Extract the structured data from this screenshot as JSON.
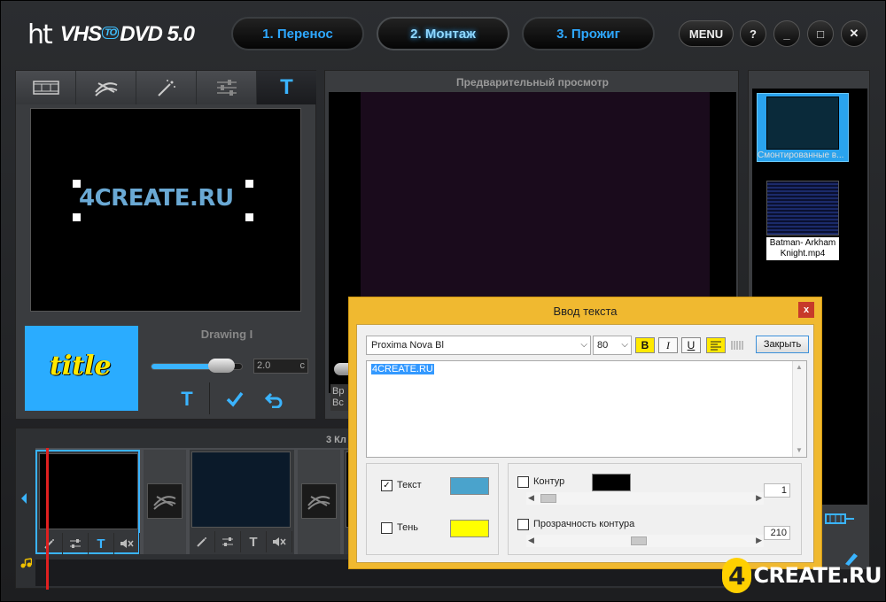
{
  "app": {
    "logo_ht": "ht",
    "logo_vhs": "VHS",
    "logo_to": "TO",
    "logo_dvd": "DVD 5.0"
  },
  "steps": [
    {
      "label": "1. Перенос",
      "active": false
    },
    {
      "label": "2. Монтаж",
      "active": true
    },
    {
      "label": "3. Прожиг",
      "active": false
    }
  ],
  "window_controls": {
    "menu": "MENU",
    "help": "?",
    "minimize": "_",
    "maximize": "□",
    "close": "✕"
  },
  "editor": {
    "canvas_text": "4CREATE.RU",
    "title_thumb_text": "title",
    "style_label": "Drawing I",
    "duration_value": "2.0",
    "duration_unit": "c",
    "duration_fraction": 0.77
  },
  "preview": {
    "title": "Предварительный просмотр",
    "info_line1": "Вр",
    "info_line2": "Вс"
  },
  "media": {
    "items": [
      {
        "label": "Смонтированные в..."
      },
      {
        "label": "Batman- Arkham Knight.mp4"
      }
    ]
  },
  "timeline": {
    "clip_count_label": "3 Кл"
  },
  "dialog": {
    "title": "Ввод текста",
    "close": "x",
    "font": "Proxima Nova Bl",
    "size": "80",
    "bold": "B",
    "italic": "I",
    "underline": "U",
    "close_button": "Закрыть",
    "text_value": "4CREATE.RU",
    "text_label": "Текст",
    "text_checked": true,
    "text_color": "#4aa3cc",
    "shadow_label": "Тень",
    "shadow_checked": false,
    "shadow_color": "#ffff00",
    "outline_label": "Контур",
    "outline_checked": false,
    "outline_color": "#000000",
    "outline_value": "1",
    "outline_opacity_label": "Прозрачность контура",
    "outline_opacity_checked": false,
    "outline_opacity_value": "210"
  },
  "watermark": {
    "digit": "4",
    "text": "CREATE.RU"
  },
  "colors": {
    "accent": "#3ab4ff",
    "dialog_frame": "#f0b930"
  }
}
